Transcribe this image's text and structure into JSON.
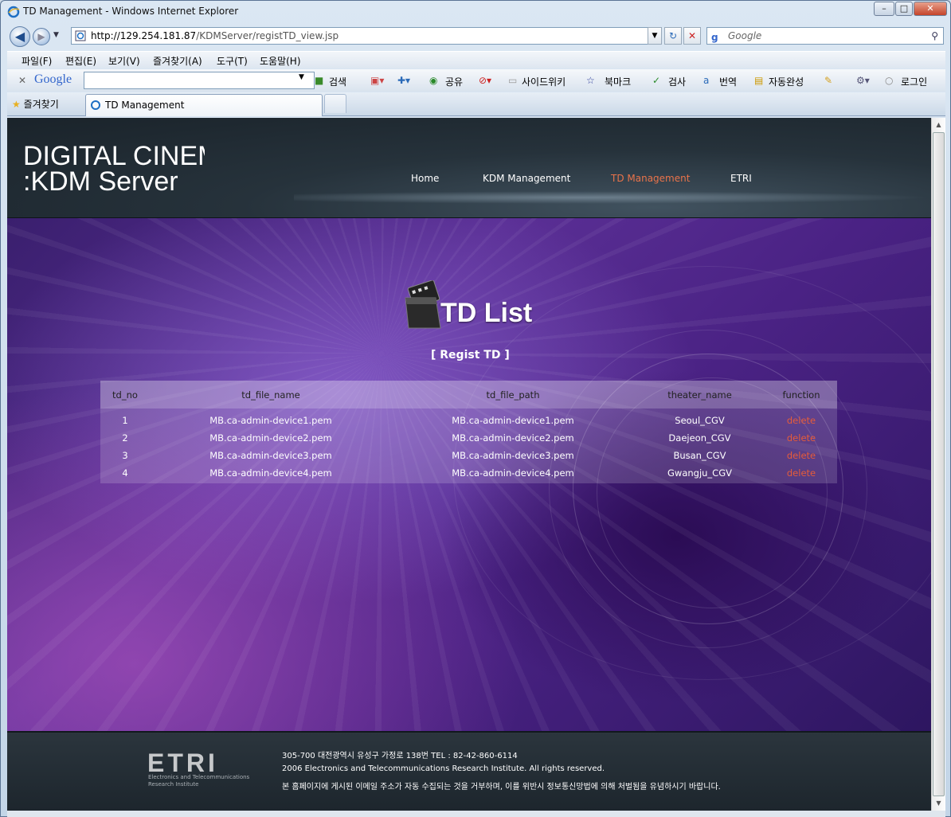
{
  "window": {
    "title": "TD Management - Windows Internet Explorer",
    "minimize": "–",
    "maximize": "□",
    "close": "✕"
  },
  "address": {
    "url_host": "http://129.254.181.87",
    "url_path": "/KDMServer/registTD_view.jsp",
    "search_placeholder": "Google"
  },
  "menu": [
    "파일(F)",
    "편집(E)",
    "보기(V)",
    "즐겨찾기(A)",
    "도구(T)",
    "도움말(H)"
  ],
  "google_toolbar": {
    "brand": "Google",
    "items": [
      "검색",
      "공유",
      "사이드위키",
      "북마크",
      "검사",
      "번역",
      "자동완성",
      "로그인"
    ]
  },
  "tabs": {
    "favorites": "즐겨찾기",
    "active_tab": "TD Management"
  },
  "site": {
    "logo_line1": "DIGITAL CINEMA",
    "logo_line2": ":KDM Server",
    "nav": [
      "Home",
      "KDM Management",
      "TD Management",
      "ETRI"
    ],
    "active_nav": "TD Management"
  },
  "page": {
    "title": "TD List",
    "regist_link": "[ Regist TD ]"
  },
  "table": {
    "columns": [
      "td_no",
      "td_file_name",
      "td_file_path",
      "theater_name",
      "function"
    ],
    "rows": [
      [
        "1",
        "MB.ca-admin-device1.pem",
        "MB.ca-admin-device1.pem",
        "Seoul_CGV",
        "delete"
      ],
      [
        "2",
        "MB.ca-admin-device2.pem",
        "MB.ca-admin-device2.pem",
        "Daejeon_CGV",
        "delete"
      ],
      [
        "3",
        "MB.ca-admin-device3.pem",
        "MB.ca-admin-device3.pem",
        "Busan_CGV",
        "delete"
      ],
      [
        "4",
        "MB.ca-admin-device4.pem",
        "MB.ca-admin-device4.pem",
        "Gwangju_CGV",
        "delete"
      ]
    ]
  },
  "footer": {
    "logo": "ETRI",
    "logo_sub": "Electronics and Telecommunications Research Institute",
    "address": "305-700 대전광역시 유성구 가정로 138번 TEL : 82-42-860-6114",
    "copyright": "2006 Electronics and Telecommunications Research Institute. All rights reserved.",
    "notice": "본 홈페이지에 게시된 이메일 주소가 자동 수집되는 것을 거부하며, 이를 위반시 정보통신망법에 의해 처벌됨을 유념하시기 바랍니다."
  },
  "colors": {
    "active_nav": "#e9734a",
    "delete_link": "#e65c3a",
    "content_purple": "#4a2284"
  }
}
